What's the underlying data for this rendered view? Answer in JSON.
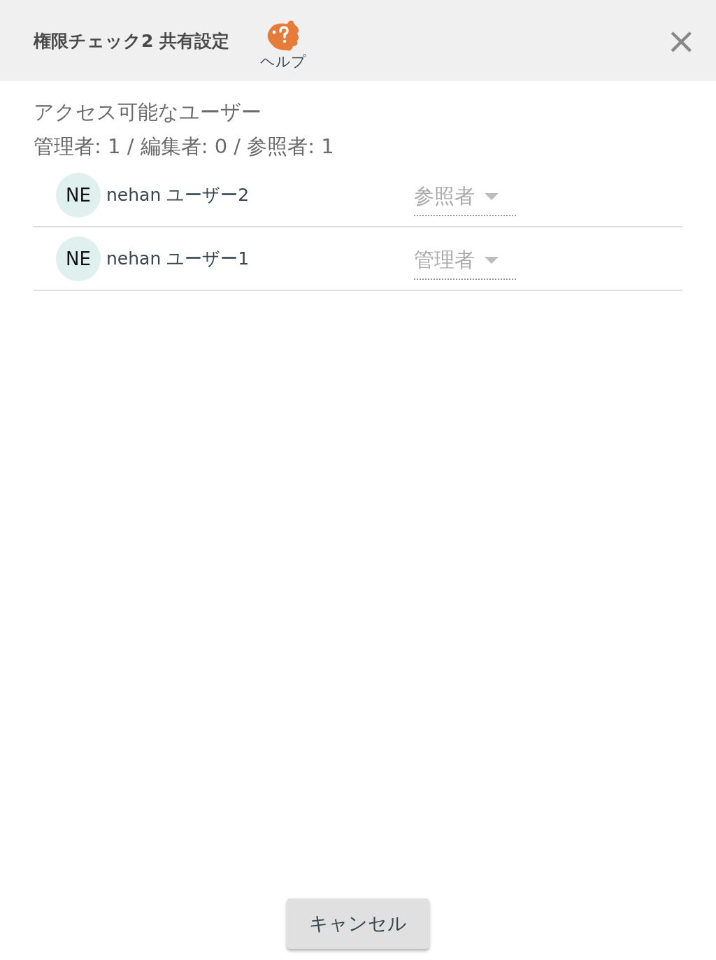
{
  "header": {
    "title": "権限チェック2 共有設定",
    "help_label": "ヘルプ",
    "close": "×"
  },
  "section_title": "アクセス可能なユーザー",
  "counts": "管理者: 1 / 編集者: 0 / 参照者: 1",
  "users": [
    {
      "initials": "NE",
      "name": "nehan ユーザー2",
      "role": "参照者",
      "disabled": true
    },
    {
      "initials": "NE",
      "name": "nehan ユーザー1",
      "role": "管理者",
      "disabled": true
    }
  ],
  "buttons": [
    "キャンセル"
  ]
}
